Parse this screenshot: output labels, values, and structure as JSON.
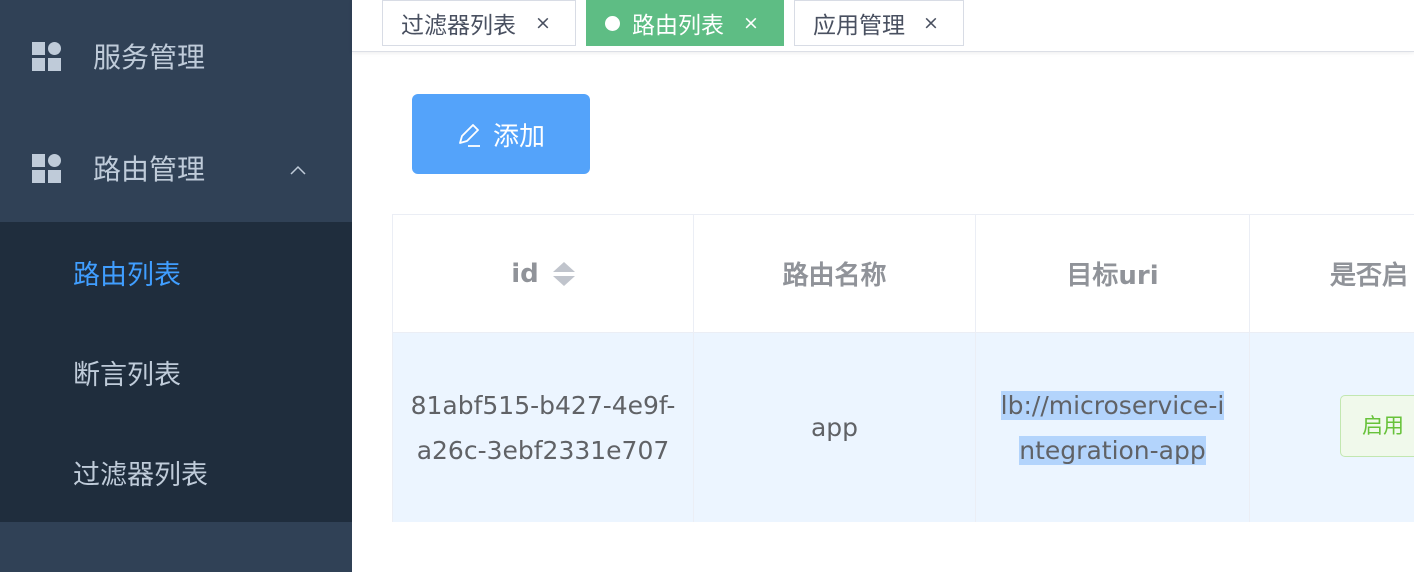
{
  "sidebar": {
    "menus": [
      {
        "label": "服务管理",
        "icon": "grid-icon"
      },
      {
        "label": "路由管理",
        "icon": "grid-icon",
        "expanded": true
      }
    ],
    "submenu": [
      {
        "label": "路由列表",
        "active": true
      },
      {
        "label": "断言列表",
        "active": false
      },
      {
        "label": "过滤器列表",
        "active": false
      }
    ]
  },
  "tabs": [
    {
      "label": "过滤器列表",
      "close": "×",
      "active": false
    },
    {
      "label": "路由列表",
      "close": "×",
      "active": true
    },
    {
      "label": "应用管理",
      "close": "×",
      "active": false
    }
  ],
  "toolbar": {
    "add_label": "添加",
    "add_icon": "edit-icon"
  },
  "table": {
    "columns": [
      "id",
      "路由名称",
      "目标uri",
      "是否启"
    ],
    "rows": [
      {
        "id": "81abf515-b427-4e9f-a26c-3ebf2331e707",
        "name": "app",
        "uri": "lb://microservice-integration-app",
        "status": "启用"
      }
    ]
  },
  "colors": {
    "sidebar_bg": "#304156",
    "submenu_bg": "#1f2d3d",
    "active_text": "#409eff",
    "active_tab": "#5ebd84",
    "primary_button": "#54a3fa",
    "row_highlight": "#ecf5ff",
    "success_tag": "#67c23a"
  }
}
